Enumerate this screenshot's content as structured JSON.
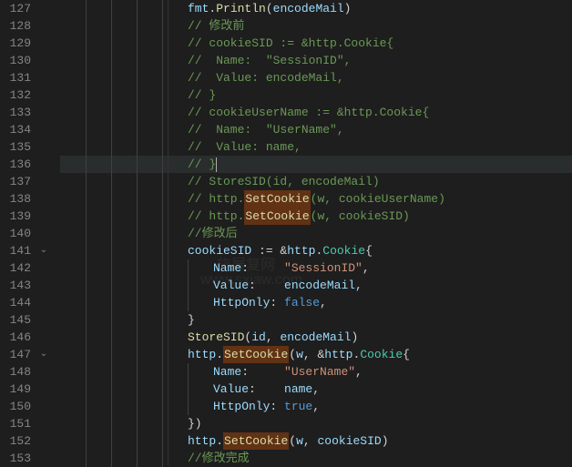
{
  "lines": [
    {
      "num": "127",
      "indent": 5,
      "segs": [
        [
          "ident",
          "fmt"
        ],
        [
          "punc",
          "."
        ],
        [
          "call",
          "Println"
        ],
        [
          "punc",
          "("
        ],
        [
          "ident",
          "encodeMail"
        ],
        [
          "punc",
          ")"
        ]
      ]
    },
    {
      "num": "128",
      "indent": 5,
      "segs": [
        [
          "comment",
          "// 修改前"
        ]
      ]
    },
    {
      "num": "129",
      "indent": 5,
      "segs": [
        [
          "comment",
          "// cookieSID := &http.Cookie{"
        ]
      ]
    },
    {
      "num": "130",
      "indent": 5,
      "segs": [
        [
          "comment",
          "//  Name:  \"SessionID\","
        ]
      ]
    },
    {
      "num": "131",
      "indent": 5,
      "segs": [
        [
          "comment",
          "//  Value: encodeMail,"
        ]
      ]
    },
    {
      "num": "132",
      "indent": 5,
      "segs": [
        [
          "comment",
          "// }"
        ]
      ]
    },
    {
      "num": "133",
      "indent": 5,
      "segs": [
        [
          "comment",
          "// cookieUserName := &http.Cookie{"
        ]
      ]
    },
    {
      "num": "134",
      "indent": 5,
      "segs": [
        [
          "comment",
          "//  Name:  \"UserName\","
        ]
      ]
    },
    {
      "num": "135",
      "indent": 5,
      "segs": [
        [
          "comment",
          "//  Value: name,"
        ]
      ]
    },
    {
      "num": "136",
      "indent": 5,
      "segs": [
        [
          "comment",
          "// }"
        ]
      ],
      "hl": true,
      "cursor": true
    },
    {
      "num": "137",
      "indent": 5,
      "segs": [
        [
          "comment",
          "// StoreSID(id, encodeMail)"
        ]
      ]
    },
    {
      "num": "138",
      "indent": 5,
      "segs": [
        [
          "comment",
          "// http."
        ],
        [
          "setcookie",
          "SetCookie"
        ],
        [
          "comment",
          "(w, cookieUserName)"
        ]
      ]
    },
    {
      "num": "139",
      "indent": 5,
      "segs": [
        [
          "comment",
          "// http."
        ],
        [
          "setcookie",
          "SetCookie"
        ],
        [
          "comment",
          "(w, cookieSID)"
        ]
      ]
    },
    {
      "num": "140",
      "indent": 5,
      "segs": [
        [
          "comment",
          "//修改后"
        ]
      ]
    },
    {
      "num": "141",
      "indent": 5,
      "fold": true,
      "segs": [
        [
          "ident",
          "cookieSID"
        ],
        [
          "punc",
          " := &"
        ],
        [
          "ident",
          "http"
        ],
        [
          "punc",
          "."
        ],
        [
          "type",
          "Cookie"
        ],
        [
          "punc",
          "{"
        ]
      ]
    },
    {
      "num": "142",
      "indent": 6,
      "segs": [
        [
          "ident",
          "Name"
        ],
        [
          "punc",
          ":     "
        ],
        [
          "string",
          "\"SessionID\""
        ],
        [
          "punc",
          ","
        ]
      ]
    },
    {
      "num": "143",
      "indent": 6,
      "segs": [
        [
          "ident",
          "Value"
        ],
        [
          "punc",
          ":    "
        ],
        [
          "ident",
          "encodeMail"
        ],
        [
          "punc",
          ","
        ]
      ]
    },
    {
      "num": "144",
      "indent": 6,
      "segs": [
        [
          "ident",
          "HttpOnly"
        ],
        [
          "punc",
          ": "
        ],
        [
          "const",
          "false"
        ],
        [
          "punc",
          ","
        ]
      ]
    },
    {
      "num": "145",
      "indent": 5,
      "segs": [
        [
          "punc",
          "}"
        ]
      ]
    },
    {
      "num": "146",
      "indent": 5,
      "segs": [
        [
          "call",
          "StoreSID"
        ],
        [
          "punc",
          "("
        ],
        [
          "ident",
          "id"
        ],
        [
          "punc",
          ", "
        ],
        [
          "ident",
          "encodeMail"
        ],
        [
          "punc",
          ")"
        ]
      ]
    },
    {
      "num": "147",
      "indent": 5,
      "fold": true,
      "segs": [
        [
          "ident",
          "http"
        ],
        [
          "punc",
          "."
        ],
        [
          "setcookie",
          "SetCookie"
        ],
        [
          "punc",
          "("
        ],
        [
          "ident",
          "w"
        ],
        [
          "punc",
          ", &"
        ],
        [
          "ident",
          "http"
        ],
        [
          "punc",
          "."
        ],
        [
          "type",
          "Cookie"
        ],
        [
          "punc",
          "{"
        ]
      ]
    },
    {
      "num": "148",
      "indent": 6,
      "segs": [
        [
          "ident",
          "Name"
        ],
        [
          "punc",
          ":     "
        ],
        [
          "string",
          "\"UserName\""
        ],
        [
          "punc",
          ","
        ]
      ]
    },
    {
      "num": "149",
      "indent": 6,
      "segs": [
        [
          "ident",
          "Value"
        ],
        [
          "punc",
          ":    "
        ],
        [
          "ident",
          "name"
        ],
        [
          "punc",
          ","
        ]
      ]
    },
    {
      "num": "150",
      "indent": 6,
      "segs": [
        [
          "ident",
          "HttpOnly"
        ],
        [
          "punc",
          ": "
        ],
        [
          "const",
          "true"
        ],
        [
          "punc",
          ","
        ]
      ]
    },
    {
      "num": "151",
      "indent": 5,
      "segs": [
        [
          "punc",
          "})"
        ]
      ]
    },
    {
      "num": "152",
      "indent": 5,
      "segs": [
        [
          "ident",
          "http"
        ],
        [
          "punc",
          "."
        ],
        [
          "setcookie",
          "SetCookie"
        ],
        [
          "punc",
          "("
        ],
        [
          "ident",
          "w"
        ],
        [
          "punc",
          ", "
        ],
        [
          "ident",
          "cookieSID"
        ],
        [
          "punc",
          ")"
        ]
      ]
    },
    {
      "num": "153",
      "indent": 5,
      "segs": [
        [
          "comment",
          "//修改完成"
        ]
      ]
    }
  ],
  "watermark1": "施展复网",
  "watermark2": "www.sxiaw.com"
}
